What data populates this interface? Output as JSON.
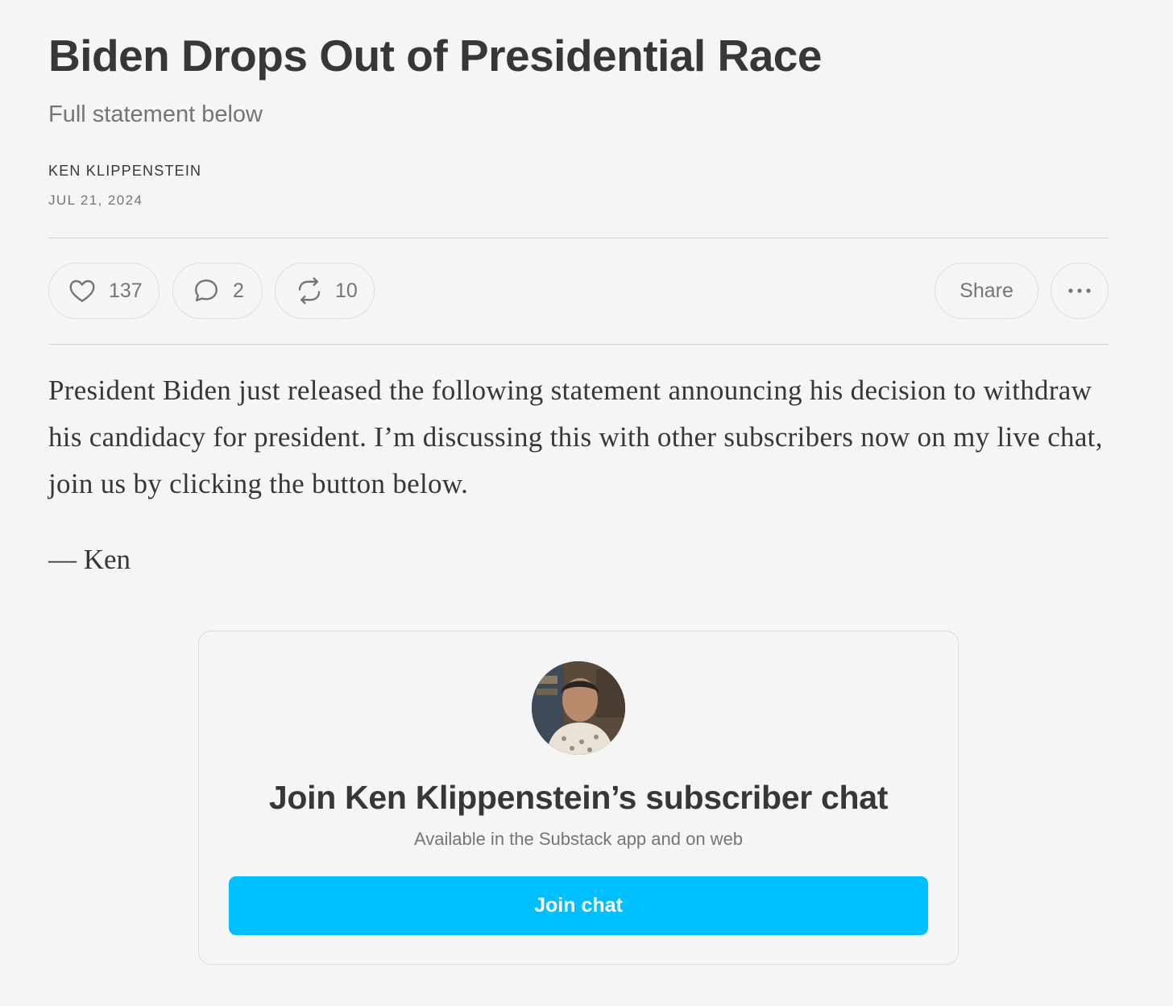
{
  "post": {
    "title": "Biden Drops Out of Presidential Race",
    "subtitle": "Full statement below",
    "author": "KEN KLIPPENSTEIN",
    "date": "JUL 21, 2024"
  },
  "actions": {
    "likes": "137",
    "comments": "2",
    "restacks": "10",
    "share_label": "Share",
    "icons": [
      "heart-icon",
      "comment-icon",
      "restack-icon",
      "more-icon"
    ]
  },
  "body": {
    "paragraph": "President Biden just released the following statement announcing his decision to withdraw his candidacy for president. I’m discussing this with other subscribers now on my live chat, join us by clicking the button below.",
    "signoff": "— Ken"
  },
  "chat_card": {
    "title": "Join Ken Klippenstein’s subscriber chat",
    "subtitle": "Available in the Substack app and on web",
    "button_label": "Join chat",
    "button_color": "#00bfff"
  }
}
